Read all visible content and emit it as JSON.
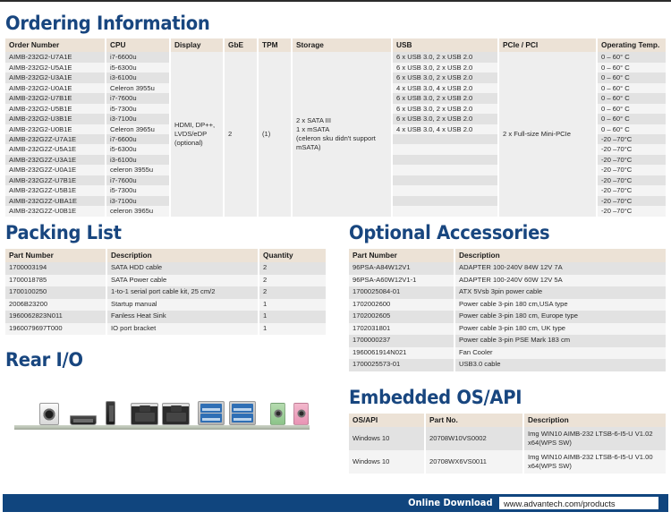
{
  "ordering": {
    "title": "Ordering Information",
    "columns": [
      "Order Number",
      "CPU",
      "Display",
      "GbE",
      "TPM",
      "Storage",
      "USB",
      "PCIe / PCI",
      "Operating Temp."
    ],
    "rows": [
      {
        "order_number": "AIMB-232G2-U7A1E",
        "cpu": "i7-6600u",
        "usb": "6 x USB 3.0, 2 x USB 2.0",
        "temp": "0 – 60° C"
      },
      {
        "order_number": "AIMB-232G2-U5A1E",
        "cpu": "i5-6300u",
        "usb": "6 x USB 3.0, 2 x USB 2.0",
        "temp": "0 – 60° C"
      },
      {
        "order_number": "AIMB-232G2-U3A1E",
        "cpu": "i3-6100u",
        "usb": "6 x USB 3.0, 2 x USB 2.0",
        "temp": "0 – 60° C"
      },
      {
        "order_number": "AIMB-232G2-U0A1E",
        "cpu": "Celeron 3955u",
        "usb": "4 x USB 3.0, 4 x USB 2.0",
        "temp": "0 – 60° C"
      },
      {
        "order_number": "AIMB-232G2-U7B1E",
        "cpu": "i7-7600u",
        "usb": "6 x USB 3.0, 2 x USB 2.0",
        "temp": "0 – 60° C"
      },
      {
        "order_number": "AIMB-232G2-U5B1E",
        "cpu": "i5-7300u",
        "usb": "6 x USB 3.0, 2 x USB 2.0",
        "temp": "0 – 60° C"
      },
      {
        "order_number": "AIMB-232G2-U3B1E",
        "cpu": "i3-7100u",
        "usb": "6 x USB 3.0, 2 x USB 2.0",
        "temp": "0 – 60° C"
      },
      {
        "order_number": "AIMB-232G2-U0B1E",
        "cpu": "Celeron 3965u",
        "usb": "4 x USB 3.0, 4 x USB 2.0",
        "temp": "0 – 60° C"
      },
      {
        "order_number": "AIMB-232G2Z-U7A1E",
        "cpu": "i7-6600u",
        "usb": "",
        "temp": "-20 –70°C"
      },
      {
        "order_number": "AIMB-232G2Z-U5A1E",
        "cpu": "i5-6300u",
        "usb": "",
        "temp": "-20 –70°C"
      },
      {
        "order_number": "AIMB-232G2Z-U3A1E",
        "cpu": "i3-6100u",
        "usb": "",
        "temp": "-20 –70°C"
      },
      {
        "order_number": "AIMB-232G2Z-U0A1E",
        "cpu": "celeron 3955u",
        "usb": "",
        "temp": "-20 –70°C"
      },
      {
        "order_number": "AIMB-232G2Z-U7B1E",
        "cpu": "i7-7600u",
        "usb": "",
        "temp": "-20 –70°C"
      },
      {
        "order_number": "AIMB-232G2Z-U5B1E",
        "cpu": "i5-7300u",
        "usb": "",
        "temp": "-20 –70°C"
      },
      {
        "order_number": "AIMB-232G2Z-UBA1E",
        "cpu": "i3-7100u",
        "usb": "",
        "temp": "-20 –70°C"
      },
      {
        "order_number": "AIMB-232G2Z-U0B1E",
        "cpu": "celeron 3965u",
        "usb": "",
        "temp": "-20 –70°C"
      }
    ],
    "merged": {
      "display": "HDMI, DP++,\nLVDS/eDP\n(optional)",
      "gbe": "2",
      "tpm": "(1)",
      "storage": "2 x SATA III\n1 x mSATA\n(celeron sku didn't support mSATA)",
      "pcie": "2 x Full-size Mini-PCIe"
    }
  },
  "packing": {
    "title": "Packing List",
    "columns": [
      "Part Number",
      "Description",
      "Quantity"
    ],
    "rows": [
      {
        "part": "1700003194",
        "desc": "SATA HDD cable",
        "qty": "2"
      },
      {
        "part": "1700018785",
        "desc": "SATA Power cable",
        "qty": "2"
      },
      {
        "part": "1700100250",
        "desc": "1-to-1 serial port cable kit, 25 cm/2",
        "qty": "2"
      },
      {
        "part": "2006B23200",
        "desc": "Startup manual",
        "qty": "1"
      },
      {
        "part": "1960062823N011",
        "desc": "Fanless Heat Sink",
        "qty": "1"
      },
      {
        "part": "1960079697T000",
        "desc": "IO port bracket",
        "qty": "1"
      }
    ]
  },
  "accessories": {
    "title": "Optional Accessories",
    "columns": [
      "Part Number",
      "Description"
    ],
    "rows": [
      {
        "part": "96PSA-A84W12V1",
        "desc": "ADAPTER 100-240V 84W 12V 7A"
      },
      {
        "part": "96PSA-A60W12V1-1",
        "desc": "ADAPTER 100-240V 60W 12V 5A"
      },
      {
        "part": "1700025084-01",
        "desc": "ATX 5Vsb 3pin power cable"
      },
      {
        "part": "1702002600",
        "desc": "Power cable 3-pin 180 cm,USA type"
      },
      {
        "part": "1702002605",
        "desc": "Power cable 3-pin 180 cm, Europe type"
      },
      {
        "part": "1702031801",
        "desc": "Power cable 3-pin 180 cm, UK type"
      },
      {
        "part": "1700000237",
        "desc": "Power cable 3-pin PSE Mark 183 cm"
      },
      {
        "part": "1960061914N021",
        "desc": "Fan Cooler"
      },
      {
        "part": "1700025573-01",
        "desc": "USB3.0 cable"
      }
    ]
  },
  "rear_io": {
    "title": "Rear I/O",
    "ports": [
      "dc-power-jack",
      "hdmi-port",
      "displayport-port",
      "rj45-lan-port-1",
      "rj45-lan-port-2",
      "usb30-port-stack-1",
      "usb30-port-stack-2",
      "audio-line-out-jack",
      "audio-mic-in-jack"
    ]
  },
  "embedded": {
    "title": "Embedded OS/API",
    "columns": [
      "OS/API",
      "Part No.",
      "Description"
    ],
    "rows": [
      {
        "os": "Windows 10",
        "part": "20708W10VS0002",
        "desc": "Img WIN10 AIMB-232 LTSB-6-I5-U V1.02 x64(WPS SW)"
      },
      {
        "os": "Windows 10",
        "part": "20708WX6VS0011",
        "desc": "Img WIN10 AIMB-232 LTSB-6-I5-U V1.00 x64(WPS SW)"
      }
    ]
  },
  "footer": {
    "label": "Online Download",
    "url": "www.advantech.com/products"
  },
  "colors": {
    "heading_blue": "#18467f",
    "footer_blue": "#10457e",
    "table_header_bg": "#ece2d6",
    "row_odd": "#e2e2e2",
    "row_even": "#f4f4f4"
  }
}
